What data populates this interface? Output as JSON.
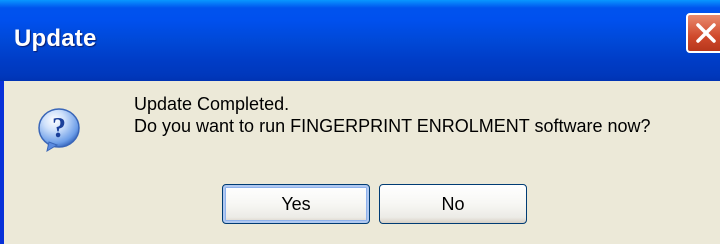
{
  "window": {
    "title": "Update"
  },
  "dialog": {
    "icon": "question-icon",
    "message_line1": "Update Completed.",
    "message_line2": "Do you want to run FINGERPRINT ENROLMENT software now?"
  },
  "buttons": {
    "yes_label": "Yes",
    "no_label": "No"
  },
  "colors": {
    "titlebar": "#0053ee",
    "body_background": "#ece9d8",
    "close_button": "#d0492b",
    "question_icon": "#2f72d8"
  }
}
